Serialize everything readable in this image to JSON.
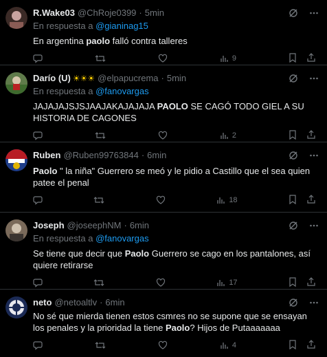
{
  "tweets": [
    {
      "name": "R.Wake03",
      "badges": "",
      "handle": "@ChRoje0399",
      "time": "5min",
      "reply_prefix": "En respuesta a",
      "reply_to": "@gianinag15",
      "text_before": "En argentina ",
      "highlight": "paolo",
      "text_after": " falló contra talleres",
      "views": "9",
      "avatar_colors": [
        "#3b2a26",
        "#c9a3a0"
      ]
    },
    {
      "name": "Darío (U)",
      "badges": "☀☀☀",
      "handle": "@elpapucrema",
      "time": "5min",
      "reply_prefix": "En respuesta a",
      "reply_to": "@fanovargas",
      "text_before": "JAJAJAJSJSJAAJAKAJAJAJA ",
      "highlight": "PAOLO",
      "text_after": " SE CAGÓ TODO GIEL A SU HISTORIA DE CAGONES",
      "views": "2",
      "avatar_colors": [
        "#5f7b4a",
        "#d7c8ad"
      ]
    },
    {
      "name": "Ruben",
      "badges": "",
      "handle": "@Ruben99763844",
      "time": "6min",
      "reply_prefix": "",
      "reply_to": "",
      "text_before": "",
      "highlight": "Paolo",
      "text_after": " \" la niña\" Guerrero se meó y le pidio a Castillo que el sea quien patee el penal",
      "views": "18",
      "avatar_colors": [
        "#b81c24",
        "#1f3e8a"
      ]
    },
    {
      "name": "Joseph",
      "badges": "",
      "handle": "@joseephNM",
      "time": "6min",
      "reply_prefix": "En respuesta a",
      "reply_to": "@fanovargas",
      "text_before": "Se tiene que decir que ",
      "highlight": "Paolo",
      "text_after": " Guerrero se cago en los pantalones, así quiere retirarse",
      "views": "17",
      "avatar_colors": [
        "#7a6a5a",
        "#cfc2b0"
      ]
    },
    {
      "name": "neto",
      "badges": "",
      "handle": "@netoaltlv",
      "time": "6min",
      "reply_prefix": "",
      "reply_to": "",
      "text_before": "No sé que mierda tienen estos csmres no se supone que se ensayan los penales y la prioridad la tiene ",
      "highlight": "Paolo",
      "text_after": "? Hijos de Putaaaaaaa",
      "views": "4",
      "avatar_colors": [
        "#1b2a55",
        "#e8e8ee"
      ]
    }
  ]
}
